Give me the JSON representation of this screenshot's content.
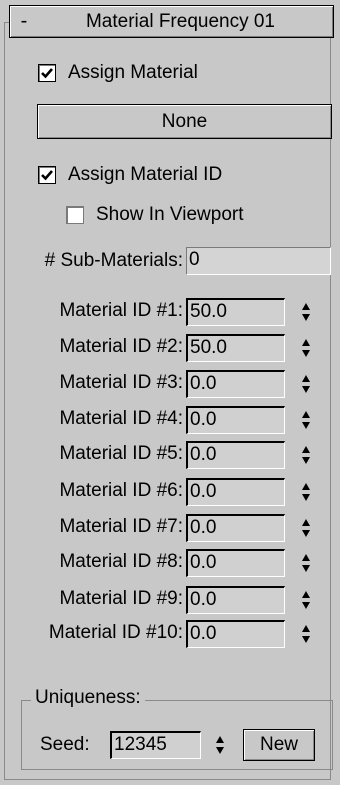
{
  "rollout": {
    "toggle": "-",
    "title": "Material Frequency 01"
  },
  "assign_material": {
    "label": "Assign Material",
    "checked": true
  },
  "material_button": {
    "label": "None"
  },
  "assign_material_id": {
    "label": "Assign Material ID",
    "checked": true
  },
  "show_in_viewport": {
    "label": "Show In Viewport",
    "checked": false
  },
  "sub_materials": {
    "label": "# Sub-Materials:",
    "value": "0"
  },
  "material_ids": [
    {
      "label": "Material ID #1:",
      "value": "50.0"
    },
    {
      "label": "Material ID #2:",
      "value": "50.0"
    },
    {
      "label": "Material ID #3:",
      "value": "0.0"
    },
    {
      "label": "Material ID #4:",
      "value": "0.0"
    },
    {
      "label": "Material ID #5:",
      "value": "0.0"
    },
    {
      "label": "Material ID #6:",
      "value": "0.0"
    },
    {
      "label": "Material ID #7:",
      "value": "0.0"
    },
    {
      "label": "Material ID #8:",
      "value": "0.0"
    },
    {
      "label": "Material ID #9:",
      "value": "0.0"
    },
    {
      "label": "Material ID #10:",
      "value": "0.0"
    }
  ],
  "uniqueness": {
    "title": "Uniqueness:",
    "seed_label": "Seed:",
    "seed_value": "12345",
    "new_label": "New"
  }
}
